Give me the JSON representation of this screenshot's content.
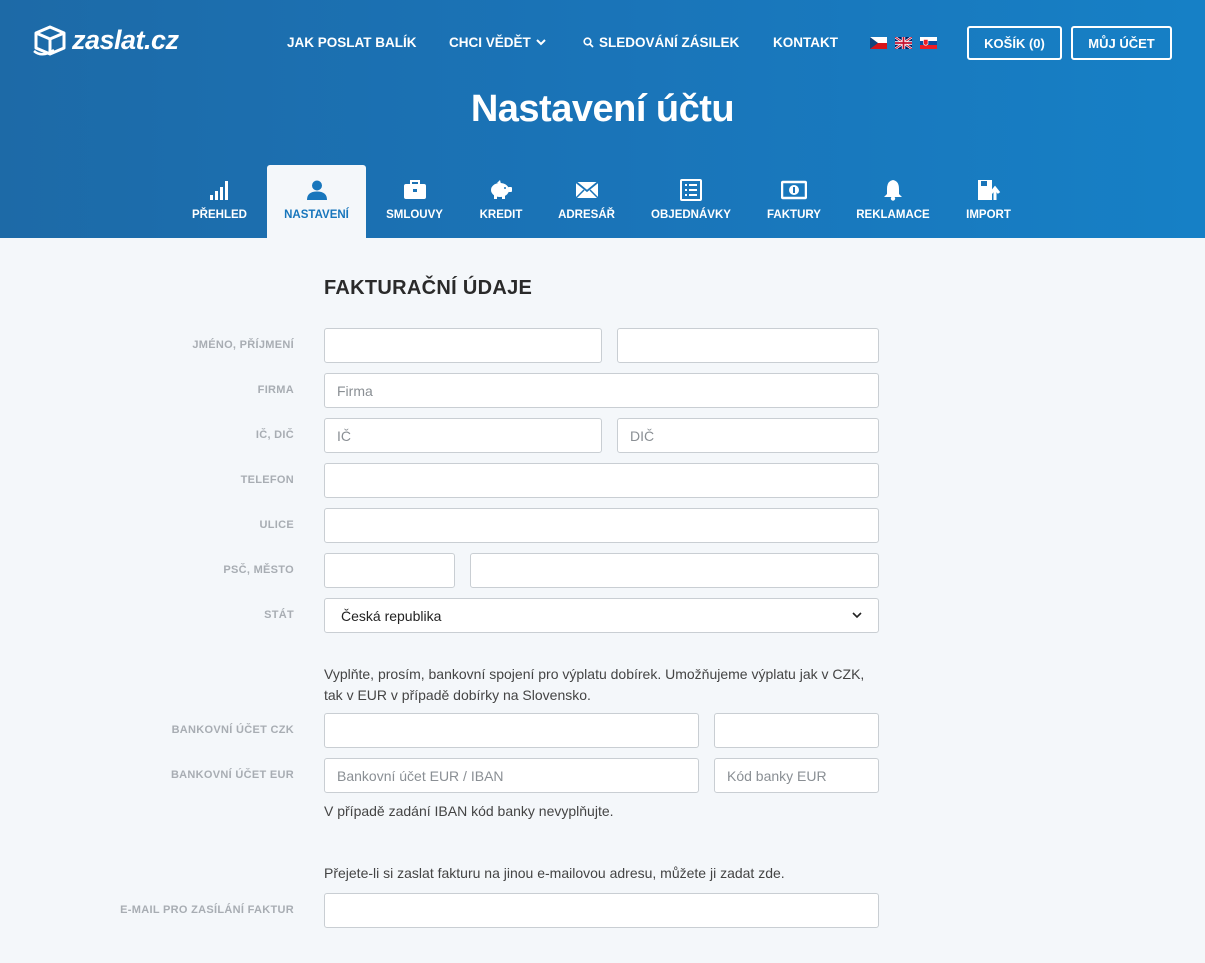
{
  "brand": {
    "logo_text": "zaslat.cz"
  },
  "nav": {
    "how_to_send": "JAK POSLAT BALÍK",
    "want_to_know": "CHCI VĚDĚT",
    "tracking": "SLEDOVÁNÍ ZÁSILEK",
    "contact": "KONTAKT"
  },
  "flags": [
    "cz-flag",
    "uk-flag",
    "sk-flag"
  ],
  "header_buttons": {
    "cart": "KOŠÍK (0)",
    "account": "MŮJ ÚČET"
  },
  "page_title": "Nastavení účtu",
  "tabs": [
    {
      "label": "PŘEHLED",
      "icon": "bar-chart-icon"
    },
    {
      "label": "NASTAVENÍ",
      "icon": "user-icon",
      "active": true
    },
    {
      "label": "SMLOUVY",
      "icon": "briefcase-icon"
    },
    {
      "label": "KREDIT",
      "icon": "piggy-bank-icon"
    },
    {
      "label": "ADRESÁŘ",
      "icon": "envelope-icon"
    },
    {
      "label": "OBJEDNÁVKY",
      "icon": "list-icon"
    },
    {
      "label": "FAKTURY",
      "icon": "banknote-icon"
    },
    {
      "label": "REKLAMACE",
      "icon": "bell-icon"
    },
    {
      "label": "IMPORT",
      "icon": "import-icon"
    }
  ],
  "form": {
    "section_title": "FAKTURAČNÍ ÚDAJE",
    "labels": {
      "name": "JMÉNO,  PŘÍJMENÍ",
      "company": "FIRMA",
      "ic_dic": "IČ,  DIČ",
      "phone": "TELEFON",
      "street": "ULICE",
      "zip_city": "PSČ,  MĚSTO",
      "country": "STÁT",
      "bank_czk": "BANKOVNÍ ÚČET CZK",
      "bank_eur": "BANKOVNÍ ÚČET EUR",
      "invoice_email": "E-MAIL PRO ZASÍLÁNÍ FAKTUR"
    },
    "placeholders": {
      "company": "Firma",
      "ic": "IČ",
      "dic": "DIČ",
      "bank_eur": "Bankovní účet EUR / IBAN",
      "bank_eur_code": "Kód banky EUR"
    },
    "country_value": "Česká republika",
    "bank_note": "Vyplňte, prosím, bankovní spojení pro výplatu dobírek. Umožňujeme výplatu jak v CZK, tak v EUR v případě dobírky na Slovensko.",
    "iban_note": "V případě zadání IBAN kód banky nevyplňujte.",
    "email_note": "Přejete-li si zaslat fakturu na jinou e-mailovou adresu, můžete ji zadat zde."
  },
  "colors": {
    "header_start": "#1d6aa7",
    "header_end": "#1680c6",
    "active_tab_text": "#1876bc",
    "page_bg": "#f4f7fa"
  }
}
